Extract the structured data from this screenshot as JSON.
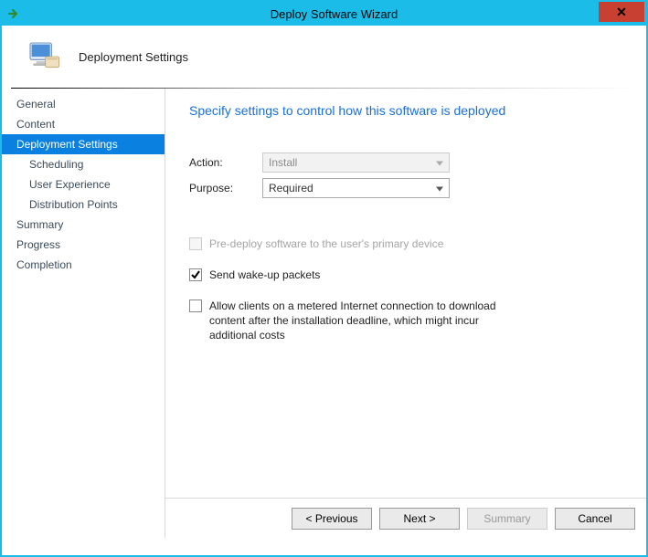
{
  "window": {
    "title": "Deploy Software Wizard"
  },
  "header": {
    "title": "Deployment Settings"
  },
  "sidebar": {
    "items": [
      {
        "label": "General",
        "indent": false,
        "selected": false
      },
      {
        "label": "Content",
        "indent": false,
        "selected": false
      },
      {
        "label": "Deployment Settings",
        "indent": false,
        "selected": true
      },
      {
        "label": "Scheduling",
        "indent": true,
        "selected": false
      },
      {
        "label": "User Experience",
        "indent": true,
        "selected": false
      },
      {
        "label": "Distribution Points",
        "indent": true,
        "selected": false
      },
      {
        "label": "Summary",
        "indent": false,
        "selected": false
      },
      {
        "label": "Progress",
        "indent": false,
        "selected": false
      },
      {
        "label": "Completion",
        "indent": false,
        "selected": false
      }
    ]
  },
  "main": {
    "page_title": "Specify settings to control how this software is deployed",
    "fields": {
      "action_label": "Action:",
      "action_value": "Install",
      "purpose_label": "Purpose:",
      "purpose_value": "Required"
    },
    "checkboxes": {
      "predeploy": {
        "label": "Pre-deploy software to the user's primary device",
        "checked": false,
        "enabled": false
      },
      "wakeup": {
        "label": "Send wake-up packets",
        "checked": true,
        "enabled": true
      },
      "metered": {
        "label": "Allow clients on a metered Internet connection to download content after the installation deadline, which might incur additional costs",
        "checked": false,
        "enabled": true
      }
    }
  },
  "buttons": {
    "previous": "< Previous",
    "next": "Next >",
    "summary": "Summary",
    "cancel": "Cancel"
  }
}
